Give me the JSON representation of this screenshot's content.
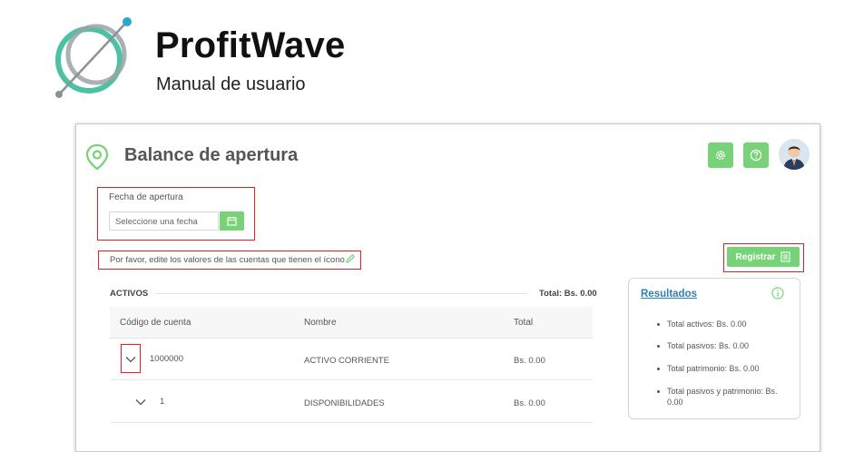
{
  "brand": {
    "title": "ProfitWave",
    "subtitle": "Manual de usuario"
  },
  "colors": {
    "accent_green": "#78d278",
    "logo_teal": "#4cc2a5",
    "logo_gray": "#9aa3a7",
    "highlight_red": "#e02020",
    "link_blue": "#2c7fb8"
  },
  "page": {
    "title": "Balance de apertura",
    "header_icons": [
      "gear-icon",
      "help-icon",
      "avatar"
    ]
  },
  "fecha": {
    "label": "Fecha de apertura",
    "placeholder": "Seleccione una fecha"
  },
  "note": "Por favor, edite los valores de las cuentas que tienen el ícono",
  "register": {
    "label": "Registrar"
  },
  "activos": {
    "label": "ACTIVOS",
    "total": "Total: Bs. 0.00",
    "columns": [
      "Código de cuenta",
      "Nombre",
      "Total"
    ],
    "rows": [
      {
        "code": "1000000",
        "name": "ACTIVO CORRIENTE",
        "total": "Bs. 0.00"
      },
      {
        "code": "1",
        "name": "DISPONIBILIDADES",
        "total": "Bs. 0.00"
      }
    ]
  },
  "resultados": {
    "title": "Resultados",
    "items": [
      "Total activos: Bs. 0.00",
      "Total pasivos: Bs. 0.00",
      "Total patrimonio: Bs. 0.00",
      "Total pasivos y patrimonio: Bs. 0.00"
    ]
  }
}
